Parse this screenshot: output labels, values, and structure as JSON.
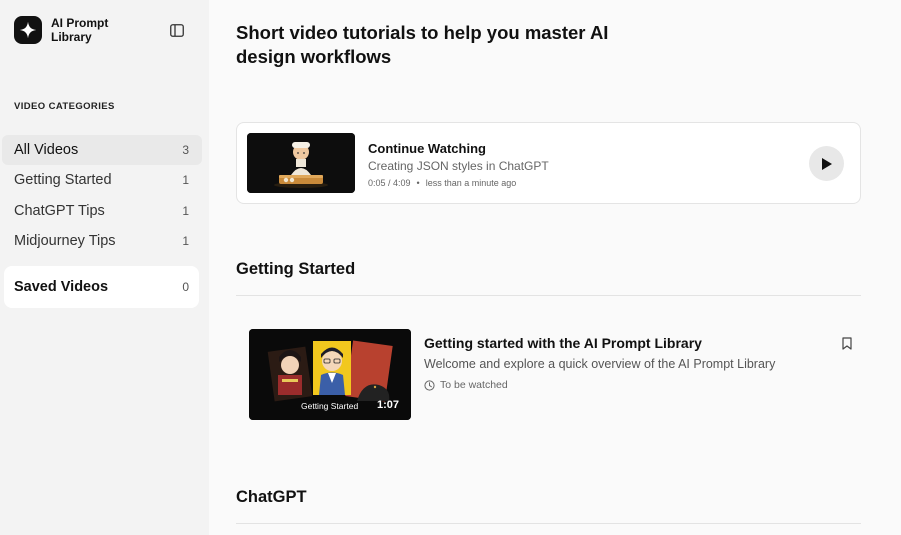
{
  "brand": {
    "name": "AI Prompt Library",
    "logo_icon": "sparkle-icon"
  },
  "sidebar": {
    "toggle_icon": "sidebar-toggle-icon",
    "categories_heading": "VIDEO CATEGORIES",
    "categories": [
      {
        "label": "All Videos",
        "count": "3",
        "active": true
      },
      {
        "label": "Getting Started",
        "count": "1"
      },
      {
        "label": "ChatGPT Tips",
        "count": "1"
      },
      {
        "label": "Midjourney Tips",
        "count": "1"
      }
    ],
    "saved": {
      "label": "Saved Videos",
      "count": "0"
    }
  },
  "main": {
    "title": "Short video tutorials to help you master AI design workflows",
    "continue_watching": {
      "heading": "Continue Watching",
      "video_title": "Creating JSON styles in ChatGPT",
      "progress": "0:05 / 4:09",
      "separator": "•",
      "last_watched": "less than a minute ago",
      "play_icon": "play-icon"
    },
    "sections": [
      {
        "title": "Getting Started",
        "videos": [
          {
            "title": "Getting started with the AI Prompt Library",
            "description": "Welcome and explore a quick overview of the AI Prompt Library",
            "status": "To be watched",
            "thumbnail_caption": "Getting Started",
            "duration": "1:07",
            "status_icon": "clock-icon",
            "bookmark_icon": "bookmark-icon"
          }
        ]
      },
      {
        "title": "ChatGPT"
      }
    ]
  },
  "colors": {
    "sidebar_bg": "#f3f3f3",
    "main_bg": "#fafafa",
    "active_item_bg": "#e9e9e9",
    "accent": "#111111"
  }
}
